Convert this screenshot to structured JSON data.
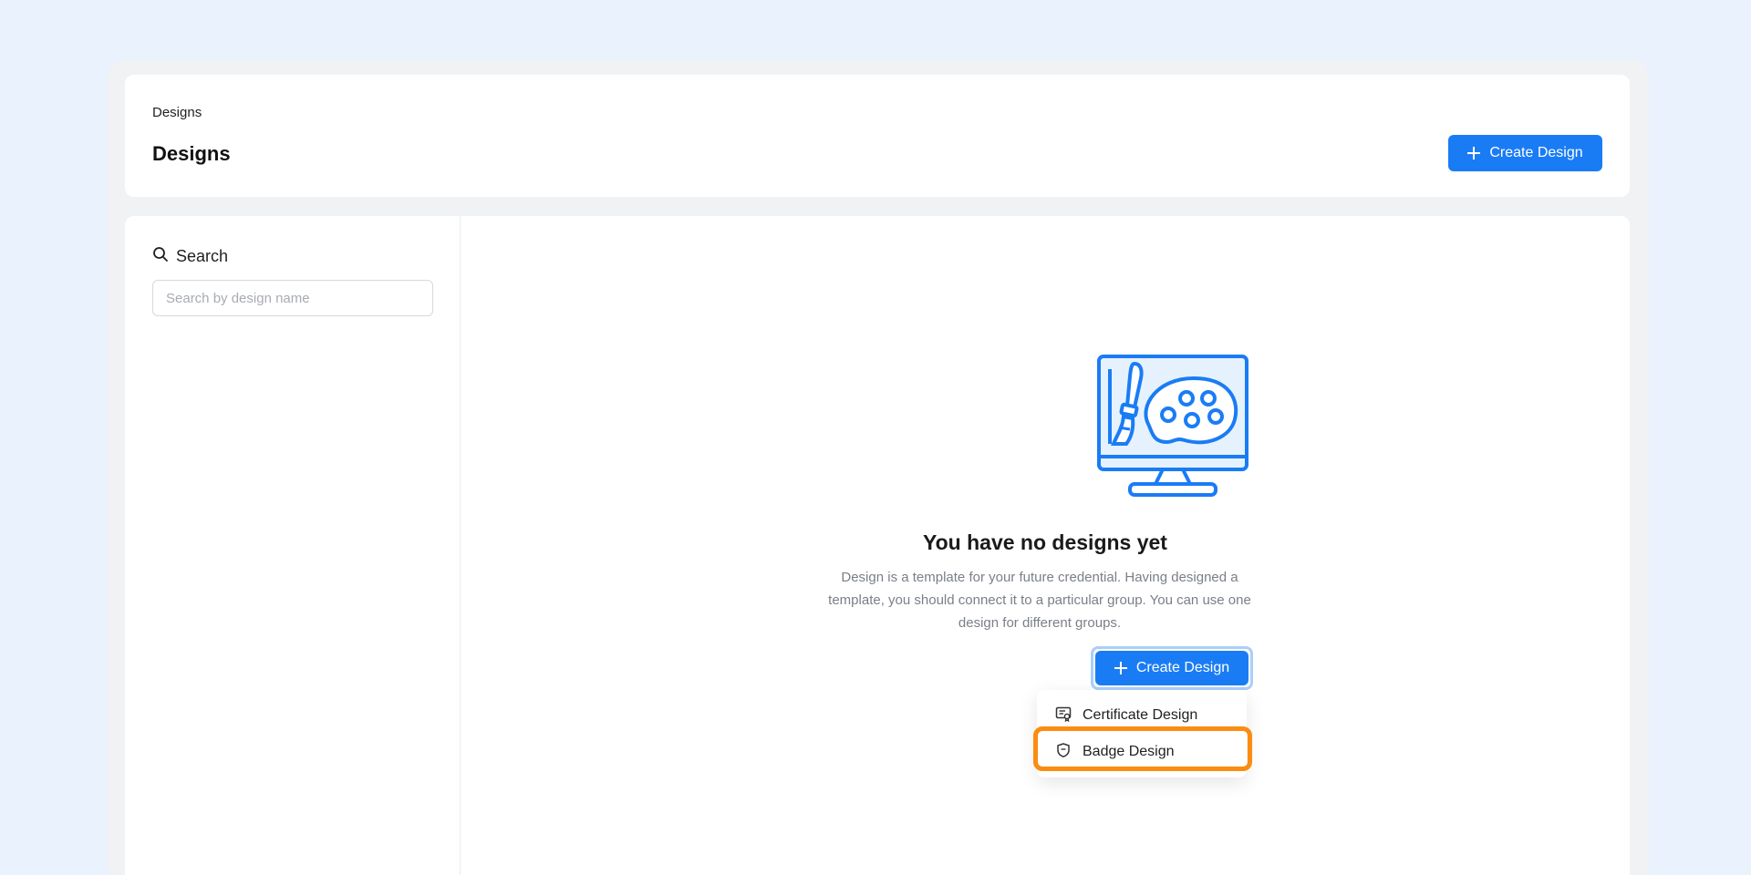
{
  "header": {
    "breadcrumb": "Designs",
    "title": "Designs",
    "create_label": "Create Design"
  },
  "sidebar": {
    "search_heading": "Search",
    "search_placeholder": "Search by design name",
    "search_value": ""
  },
  "empty_state": {
    "illustration": "monitor-palette-brush-icon",
    "title": "You have no designs yet",
    "description": "Design is a template for your future credential. Having designed a template, you should connect it to a particular group. You can use one design for different groups.",
    "create_label": "Create Design"
  },
  "dropdown": {
    "items": [
      {
        "label": "Certificate Design",
        "icon": "certificate-icon"
      },
      {
        "label": "Badge Design",
        "icon": "shield-icon",
        "highlighted": true
      }
    ]
  },
  "colors": {
    "background": "#eaf2fd",
    "primary": "#1a7cf5",
    "highlight": "#fb8c12",
    "illustration_fill": "#e5f2fd"
  }
}
